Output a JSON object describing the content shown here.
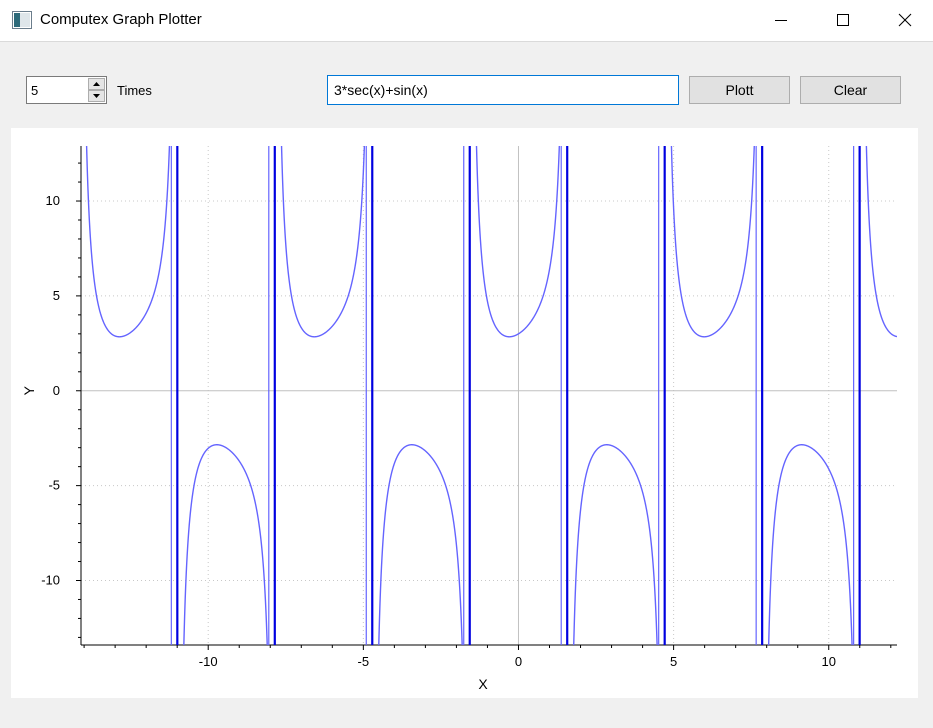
{
  "window": {
    "title": "Computex Graph Plotter",
    "icons": {
      "app": "app-icon",
      "minimize": "minimize-icon",
      "maximize": "maximize-icon",
      "close": "close-icon"
    }
  },
  "controls": {
    "times_value": "5",
    "times_label": "Times",
    "function_value": "3*sec(x)+sin(x)",
    "plot_label": "Plott",
    "clear_label": "Clear"
  },
  "colors": {
    "curve_light": "#6464ff",
    "curve_dark": "#0000e0",
    "input_focus": "#0078d7"
  },
  "chart_data": {
    "type": "line",
    "function": "3*sec(x)+sin(x)",
    "xlabel": "X",
    "ylabel": "Y",
    "xlim": [
      -14.1,
      12.2
    ],
    "ylim": [
      -13.4,
      12.9
    ],
    "x_ticks": [
      -10,
      -5,
      0,
      5,
      10
    ],
    "x_tick_labels": [
      "-10",
      "-5",
      "0",
      "5",
      "10"
    ],
    "y_ticks": [
      -10,
      -5,
      0,
      5,
      10
    ],
    "y_tick_labels": [
      "-10",
      "-5",
      "0",
      "5",
      "10"
    ],
    "grid": true,
    "legend": "none"
  }
}
